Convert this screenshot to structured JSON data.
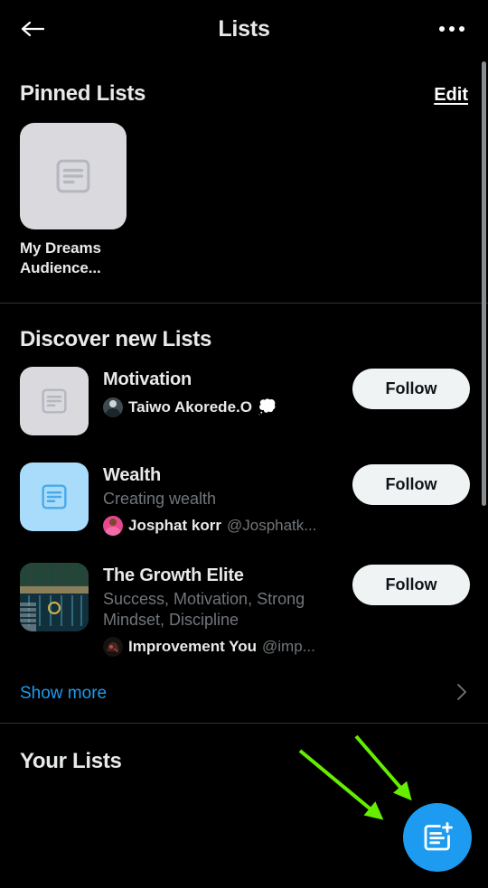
{
  "header": {
    "title": "Lists",
    "back_icon": "arrow-left-icon",
    "more_icon": "more-horizontal-icon"
  },
  "pinned": {
    "section_title": "Pinned Lists",
    "edit_label": "Edit",
    "items": [
      {
        "name": "My Dreams Audience...",
        "thumb_icon": "list-placeholder-icon",
        "thumb_color": "#d9d9de"
      }
    ]
  },
  "discover": {
    "section_title": "Discover new Lists",
    "follow_label": "Follow",
    "show_more_label": "Show more",
    "show_more_chevron": "chevron-right-icon",
    "items": [
      {
        "name": "Motivation",
        "description": "",
        "author_name": "Taiwo Akorede.O",
        "author_handle": "",
        "author_emoji": "💭",
        "thumb_type": "gray-placeholder",
        "thumb_color": "#d9d9de",
        "follow_label": "Follow"
      },
      {
        "name": "Wealth",
        "description": "Creating wealth",
        "author_name": "Josphat korr",
        "author_handle": "@Josphatk...",
        "author_emoji": "",
        "thumb_type": "blue-placeholder",
        "thumb_color": "#a9dcfb",
        "follow_label": "Follow"
      },
      {
        "name": "The Growth Elite",
        "description": "Success, Motivation, Strong Mindset, Discipline",
        "author_name": "Improvement You",
        "author_handle": "@imp...",
        "author_emoji": "",
        "thumb_type": "photo",
        "thumb_color": "#17343c",
        "follow_label": "Follow"
      }
    ]
  },
  "your_lists": {
    "section_title": "Your Lists"
  },
  "fab": {
    "icon": "create-list-icon",
    "color": "#1d9bf0"
  },
  "annotations": {
    "arrow_color": "#66ee00",
    "arrow_count": 2
  },
  "colors": {
    "background": "#000000",
    "accent_blue": "#1d9bf0",
    "text_primary": "#e7e9ea",
    "text_secondary": "#71767b",
    "divider": "#2f3336",
    "button_bg": "#eff3f4"
  }
}
